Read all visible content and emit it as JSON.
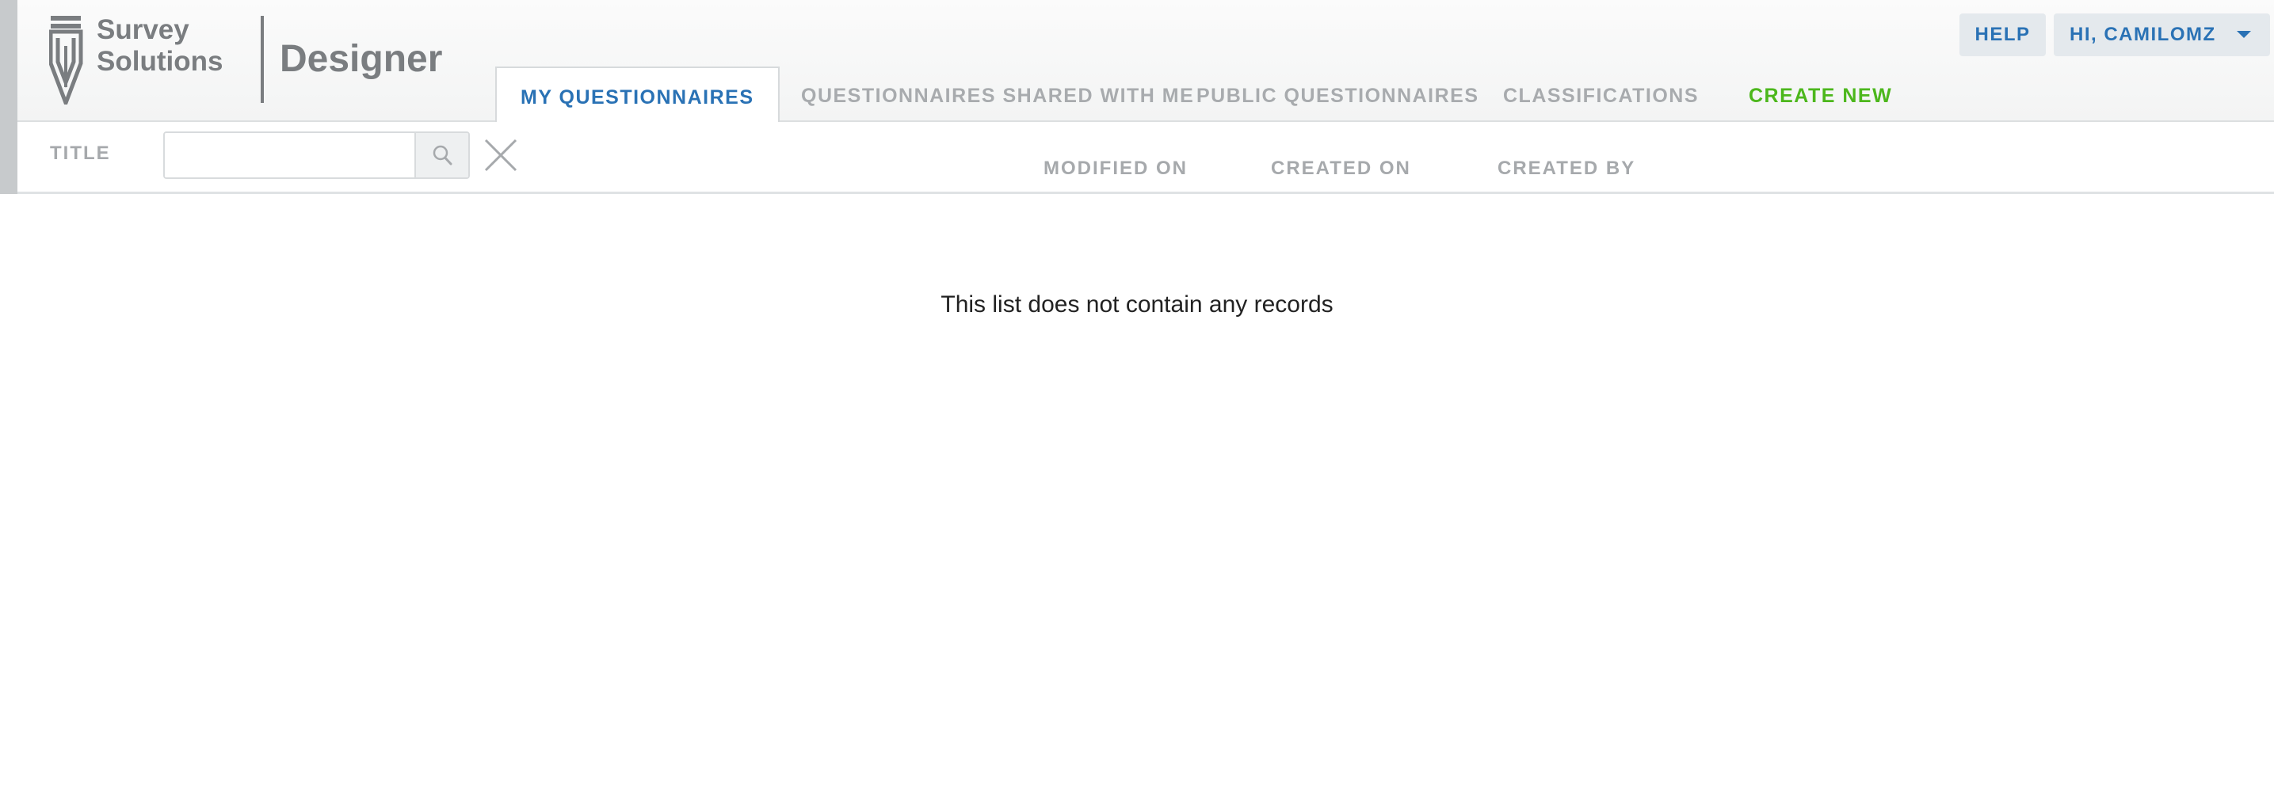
{
  "brand": {
    "line1": "Survey",
    "line2": "Solutions",
    "product": "Designer"
  },
  "nav": {
    "tabs": [
      {
        "label": "MY QUESTIONNAIRES",
        "active": true
      },
      {
        "label": "QUESTIONNAIRES SHARED WITH ME",
        "active": false
      },
      {
        "label": "PUBLIC QUESTIONNAIRES",
        "active": false
      },
      {
        "label": "CLASSIFICATIONS",
        "active": false
      },
      {
        "label": "CREATE NEW",
        "active": false
      }
    ]
  },
  "topbar": {
    "help_label": "HELP",
    "user_label": "HI, CAMILOMZ"
  },
  "filter": {
    "title_label": "TITLE",
    "search_value": "",
    "search_placeholder": ""
  },
  "columns": {
    "modified_on": "MODIFIED ON",
    "created_on": "CREATED ON",
    "created_by": "CREATED BY"
  },
  "list": {
    "empty_message": "This list does not contain any records"
  },
  "colors": {
    "accent_blue": "#2a72b5",
    "create_green": "#4cb71c",
    "muted_gray": "#a6a9ac",
    "brand_gray": "#7a7d80"
  },
  "icons": {
    "logo": "pen-nib-logo-icon",
    "search": "search-icon",
    "clear": "close-icon",
    "user_menu": "chevron-down-icon"
  }
}
